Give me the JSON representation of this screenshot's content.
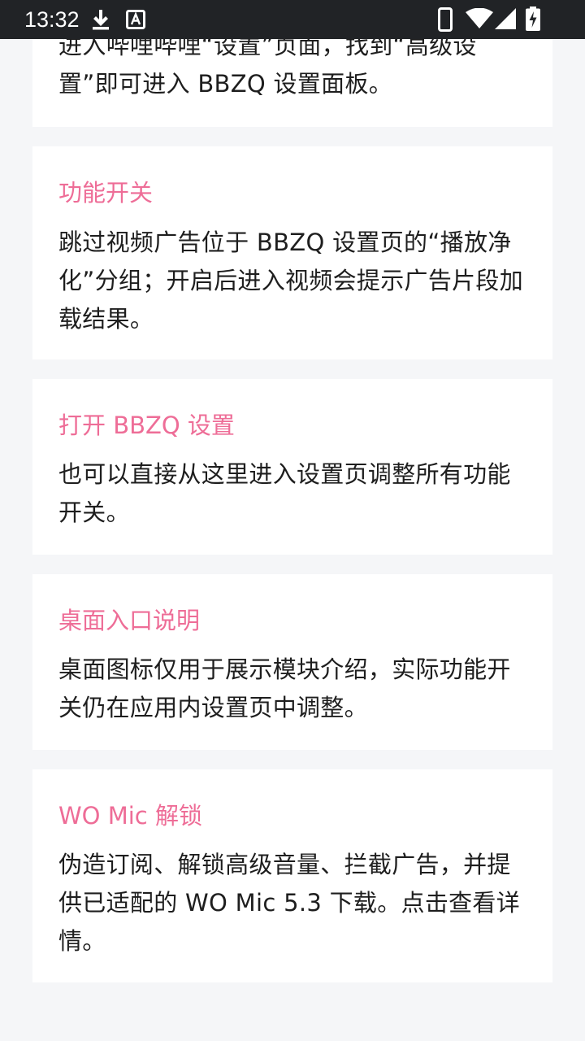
{
  "status_bar": {
    "time": "13:32",
    "icons": [
      "download-icon",
      "a-box-icon",
      "phone-icon",
      "wifi-icon",
      "signal-icon",
      "battery-charging-icon"
    ]
  },
  "cards": [
    {
      "title": "",
      "body": "进入哔哩哔哩“设置”页面，找到“高级设置”即可进入 BBZQ 设置面板。"
    },
    {
      "title": "功能开关",
      "body": "跳过视频广告位于 BBZQ 设置页的“播放净化”分组；开启后进入视频会提示广告片段加载结果。"
    },
    {
      "title": "打开 BBZQ 设置",
      "body": "也可以直接从这里进入设置页调整所有功能开关。"
    },
    {
      "title": "桌面入口说明",
      "body": "桌面图标仅用于展示模块介绍，实际功能开关仍在应用内设置页中调整。"
    },
    {
      "title": "WO Mic 解锁",
      "body": "伪造订阅、解锁高级音量、拦截广告，并提供已适配的 WO Mic 5.3 下载。点击查看详情。"
    }
  ],
  "colors": {
    "accent": "#ee6d97",
    "status_bar_bg": "#212326",
    "page_bg": "#f5f6f8",
    "card_bg": "#ffffff",
    "body_text": "#1e1e1e"
  }
}
